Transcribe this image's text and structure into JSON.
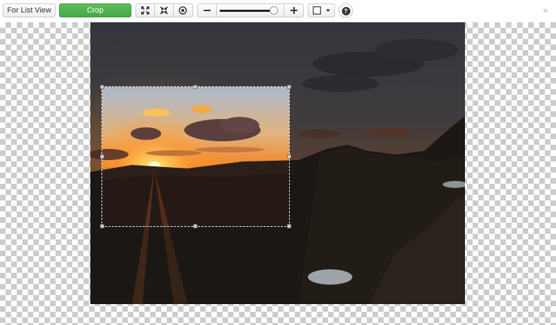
{
  "toolbar": {
    "list_view_label": "For List View",
    "crop_label": "Crop",
    "zoom_level": 0.93,
    "icons": {
      "fit": "expand-arrows-icon",
      "shrink": "compress-arrows-icon",
      "center": "target-icon",
      "zoom_out": "minus-icon",
      "zoom_in": "plus-icon",
      "aspect": "square-icon",
      "dropdown": "caret-down-icon",
      "help": "question-icon",
      "close": "close-icon"
    },
    "help_glyph": "?",
    "close_glyph": "×"
  },
  "colors": {
    "crop_button": "#4caf50",
    "checker": "#cccccc"
  },
  "image": {
    "description_semantic": "sunset-over-mountains"
  }
}
